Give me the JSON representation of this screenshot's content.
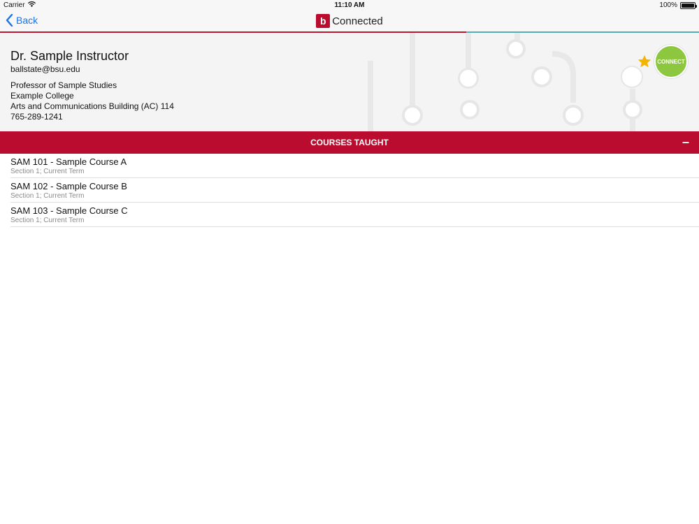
{
  "status_bar": {
    "carrier": "Carrier",
    "time": "11:10 AM",
    "battery": "100%"
  },
  "nav": {
    "back_label": "Back",
    "logo_letter": "b",
    "app_name": "Connected"
  },
  "profile": {
    "name": "Dr. Sample Instructor",
    "email": "ballstate@bsu.edu",
    "title": "Professor of Sample Studies",
    "college": "Example College",
    "office": "Arts and Communications Building (AC) 114",
    "phone": "765-289-1241",
    "connect_label": "CONNECT",
    "favorite_icon": "star-icon",
    "favorite_color": "#f5b400"
  },
  "courses_section": {
    "title": "COURSES TAUGHT",
    "collapse_label": "–",
    "items": [
      {
        "title": "SAM 101 - Sample Course A",
        "subtitle": "Section 1; Current Term"
      },
      {
        "title": "SAM 102 - Sample Course B",
        "subtitle": "Section 1; Current Term"
      },
      {
        "title": "SAM 103 - Sample Course C",
        "subtitle": "Section 1; Current Term"
      }
    ]
  },
  "colors": {
    "brand_red": "#ba0c2f",
    "accent_teal": "#4fb0b4",
    "connect_green": "#8dc63f",
    "link_blue": "#1a73e8"
  }
}
